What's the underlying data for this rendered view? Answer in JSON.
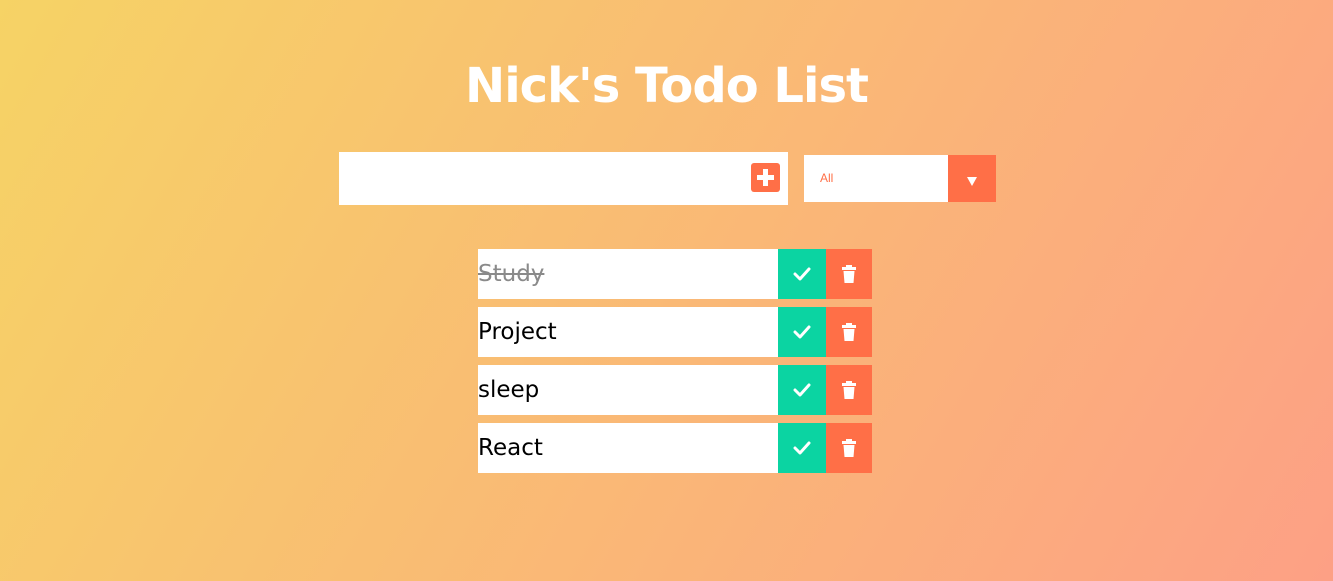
{
  "header": {
    "title": "Nick's Todo List"
  },
  "form": {
    "input_value": "",
    "add_icon": "plus-square-icon",
    "filter": {
      "selected": "All",
      "caret_icon": "caret-down-icon"
    }
  },
  "todos": [
    {
      "text": "Study",
      "completed": true
    },
    {
      "text": "Project",
      "completed": false
    },
    {
      "text": "sleep",
      "completed": false
    },
    {
      "text": "React",
      "completed": false
    }
  ],
  "icons": {
    "complete": "check-icon",
    "delete": "trash-icon"
  },
  "colors": {
    "gradient_start": "#f6d365",
    "gradient_end": "#fda085",
    "accent": "#ff6f47",
    "complete": "#0bd4a2",
    "text": "#000000",
    "completed_text": "#8a8a8a"
  }
}
